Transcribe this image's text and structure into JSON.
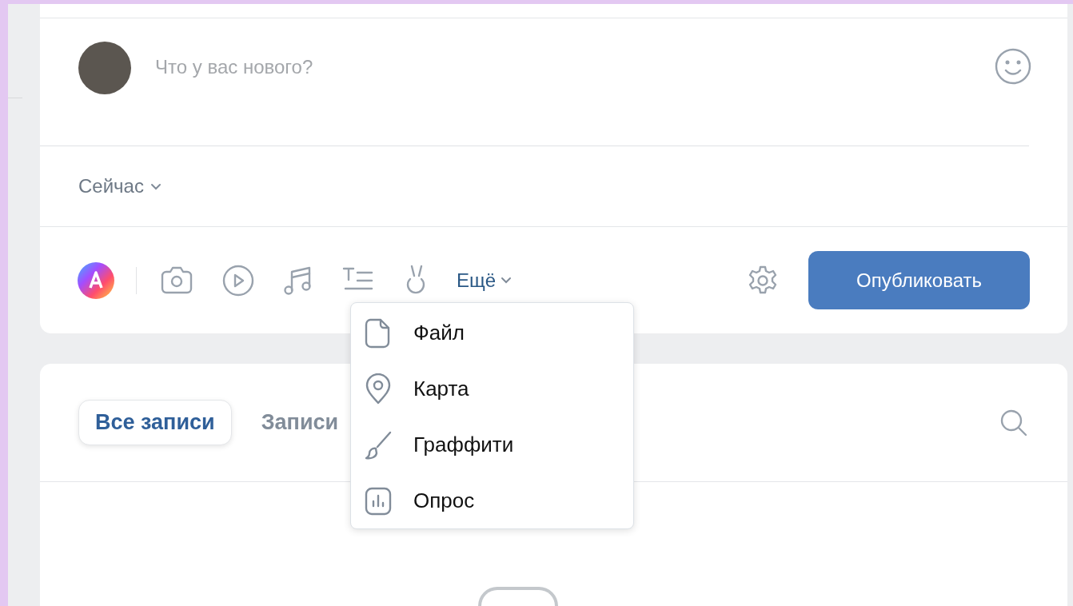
{
  "composer": {
    "placeholder": "Что у вас нового?",
    "time_option": "Сейчас",
    "more_label": "Ещё",
    "publish_button": "Опубликовать"
  },
  "more_menu": [
    {
      "kind": "file",
      "label": "Файл"
    },
    {
      "kind": "map",
      "label": "Карта"
    },
    {
      "kind": "graffiti",
      "label": "Граффити"
    },
    {
      "kind": "poll",
      "label": "Опрос"
    }
  ],
  "feed_tabs": [
    {
      "label": "Все записи",
      "selected": true
    },
    {
      "label": "Записи",
      "selected": false
    }
  ]
}
